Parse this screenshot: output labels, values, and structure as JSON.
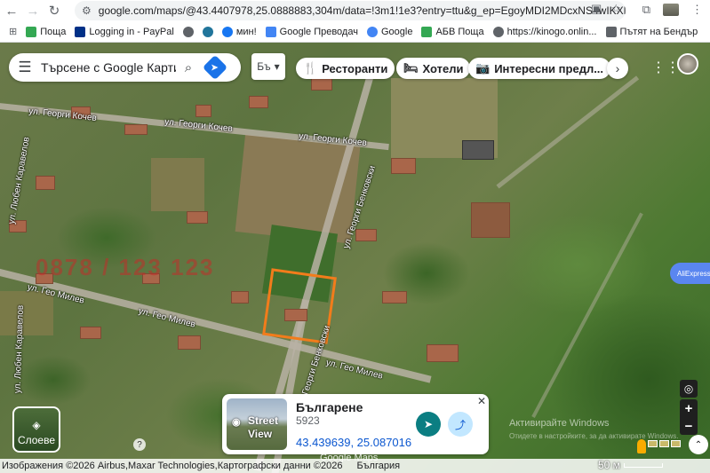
{
  "browser": {
    "url": "google.com/maps/@43.4407978,25.0888883,304m/data=!3m1!1e3?entry=ttu&g_ep=EgoyMDI2MDcxNS4wIKXMDSoASAFQ..."
  },
  "bookmarks": [
    {
      "label": "Поща",
      "icon": "mail-icon",
      "color": "#34a853"
    },
    {
      "label": "Logging in - PayPal",
      "icon": "paypal-icon",
      "color": "#003087"
    },
    {
      "label": "",
      "icon": "nav-icon",
      "color": "#5f6368"
    },
    {
      "label": "",
      "icon": "wordpress-icon",
      "color": "#21759b"
    },
    {
      "label": "мин!",
      "icon": "facebook-icon",
      "color": "#1877f2"
    },
    {
      "label": "Google Преводач",
      "icon": "translate-icon",
      "color": "#4285f4"
    },
    {
      "label": "Google",
      "icon": "google-icon",
      "color": "#4285f4"
    },
    {
      "label": "АБВ Поща",
      "icon": "abv-icon",
      "color": "#34a853"
    },
    {
      "label": "https://kinogo.onlin...",
      "icon": "globe-icon",
      "color": "#5f6368"
    },
    {
      "label": "Пътят на Бендър",
      "icon": "bookmark-icon",
      "color": "#5f6368"
    }
  ],
  "search": {
    "placeholder": "Търсене с Google Карти"
  },
  "language_button": {
    "label": "Бъ"
  },
  "chips": [
    {
      "icon": "restaurant-icon",
      "glyph": "🍴",
      "label": "Ресторанти"
    },
    {
      "icon": "hotel-icon",
      "glyph": "🛏",
      "label": "Хотели"
    },
    {
      "icon": "camera-icon",
      "glyph": "📷",
      "label": "Интересни предл..."
    }
  ],
  "streets": [
    {
      "label": "ул. Георги Кочев"
    },
    {
      "label": "ул. Георги Кочев"
    },
    {
      "label": "ул. Георги Бенковски"
    },
    {
      "label": "ул. Гео Милев"
    },
    {
      "label": "ул. Гео Милев"
    },
    {
      "label": "ул. Любен Каравелов"
    },
    {
      "label": "ул. Любен Каравелов"
    },
    {
      "label": "ул. Георги Бенковски"
    }
  ],
  "watermark_text": "0878 / 123 123",
  "aliexpress": {
    "label": "AliExpress"
  },
  "layers": {
    "label": "Слоеве"
  },
  "place_card": {
    "street_view_line1": "Street",
    "street_view_line2": "View",
    "title": "Българене",
    "subtitle": "5923",
    "coordinates": "43.439639, 25.087016"
  },
  "google_logo": "Google Maps",
  "activate_windows": {
    "title": "Активирайте Windows",
    "subtitle": "Отидете в настройките, за да активирате Windows."
  },
  "footer": {
    "attribution": "Изображения ©2026 Airbus,Maxar Technologies,Картографски данни ©2026",
    "country": "България",
    "scale": "50 м"
  },
  "colors": {
    "plot_outline": "#f27c1b",
    "direction_button": "#0b7e82",
    "link_blue": "#0b57d0"
  }
}
